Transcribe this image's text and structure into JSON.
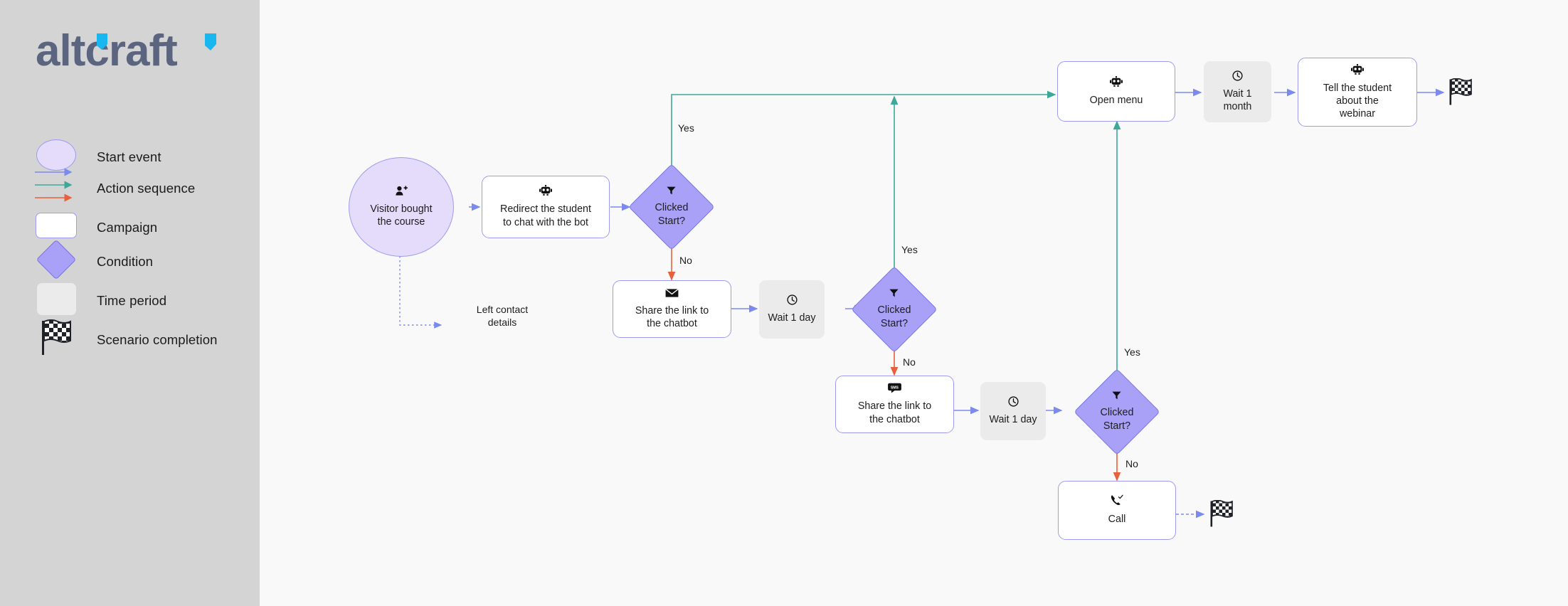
{
  "sidebar": {
    "logo_text": "altcraft",
    "legend_title": "",
    "items": [
      {
        "label": "Start event",
        "icon": "ellipse-shape-icon"
      },
      {
        "label": "Action sequence",
        "icon": "arrows-icon"
      },
      {
        "label": "Campaign",
        "icon": "rounded-rect-shape-icon"
      },
      {
        "label": "Condition",
        "icon": "diamond-shape-icon"
      },
      {
        "label": "Time period",
        "icon": "gray-rect-shape-icon"
      },
      {
        "label": "Scenario completion",
        "icon": "checkered-flag-icon"
      }
    ]
  },
  "colors": {
    "sidebar_bg": "#D4D4D4",
    "canvas_bg": "#F9F9F9",
    "node_border": "#9D9BEF",
    "condition_fill": "#A8A1F7",
    "condition_border": "#7A72E8",
    "start_fill": "#E4DCFA",
    "time_fill": "#EBEBEB",
    "arrow_blue": "#7B8AEE",
    "arrow_teal": "#3CA899",
    "arrow_red": "#E8603C",
    "dotted_blue": "#7B8AEE"
  },
  "flow": {
    "nodes": [
      {
        "id": "start",
        "type": "start",
        "icon": "person-add-icon",
        "icon_glyph": "👤⁺",
        "text": "Visitor bought\nthe course"
      },
      {
        "id": "redirect",
        "type": "campaign",
        "icon": "robot-icon",
        "icon_glyph": "🤖",
        "text": "Redirect the student\nto chat with the bot"
      },
      {
        "id": "cond1",
        "type": "condition",
        "icon": "filter-icon",
        "icon_glyph": "▼",
        "text": "Clicked\nStart?"
      },
      {
        "id": "share1",
        "type": "campaign",
        "icon": "email-icon",
        "icon_glyph": "✉",
        "text": "Share the link to\nthe chatbot"
      },
      {
        "id": "wait1",
        "type": "time",
        "icon": "clock-icon",
        "icon_glyph": "🕑",
        "text": "Wait 1 day"
      },
      {
        "id": "cond2",
        "type": "condition",
        "icon": "filter-icon",
        "icon_glyph": "▼",
        "text": "Clicked\nStart?"
      },
      {
        "id": "share2",
        "type": "campaign",
        "icon": "sms-icon",
        "icon_glyph": "SMS",
        "text": "Share the link to\nthe chatbot"
      },
      {
        "id": "wait2",
        "type": "time",
        "icon": "clock-icon",
        "icon_glyph": "🕑",
        "text": "Wait 1 day"
      },
      {
        "id": "cond3",
        "type": "condition",
        "icon": "filter-icon",
        "icon_glyph": "▼",
        "text": "Clicked\nStart?"
      },
      {
        "id": "call",
        "type": "campaign",
        "icon": "phone-call-icon",
        "icon_glyph": "📞",
        "text": "Call"
      },
      {
        "id": "openmenu",
        "type": "campaign",
        "icon": "robot-icon",
        "icon_glyph": "🤖",
        "text": "Open menu"
      },
      {
        "id": "waitmonth",
        "type": "time",
        "icon": "clock-icon",
        "icon_glyph": "🕑",
        "text": "Wait 1\nmonth"
      },
      {
        "id": "tell",
        "type": "campaign",
        "icon": "robot-icon",
        "icon_glyph": "🤖",
        "text": "Tell the student\nabout the\nwebinar"
      }
    ],
    "edge_labels": [
      {
        "id": "left-contact",
        "text": "Left contact\ndetails"
      },
      {
        "id": "yes1",
        "text": "Yes"
      },
      {
        "id": "no1",
        "text": "No"
      },
      {
        "id": "yes2",
        "text": "Yes"
      },
      {
        "id": "no2",
        "text": "No"
      },
      {
        "id": "yes3",
        "text": "Yes"
      },
      {
        "id": "no3",
        "text": "No"
      }
    ],
    "end_flags": [
      {
        "id": "flag-top",
        "label": "scenario-completion"
      },
      {
        "id": "flag-call",
        "label": "scenario-completion"
      }
    ]
  }
}
